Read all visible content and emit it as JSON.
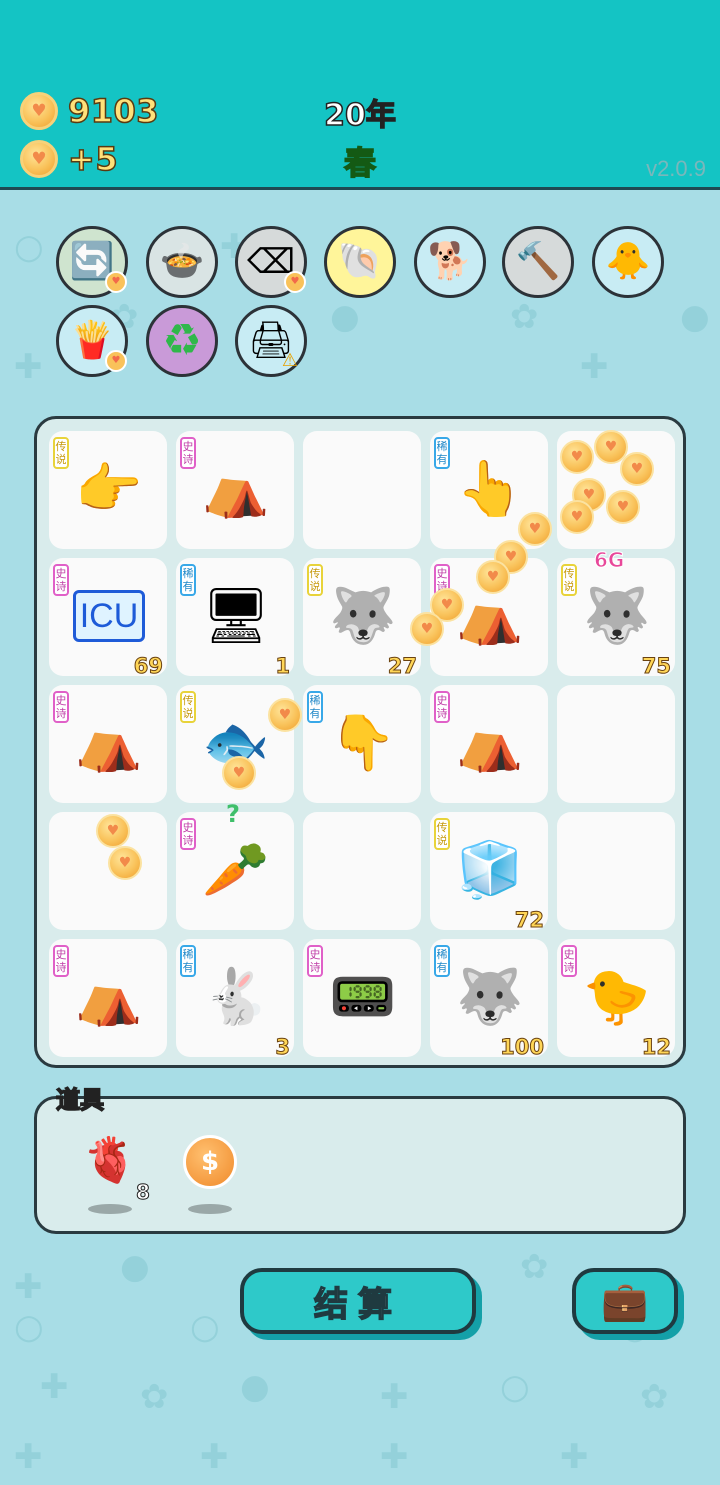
{
  "header": {
    "coins": "9103",
    "income": "+5",
    "year": "20年",
    "season": "春",
    "version": "v2.0.9"
  },
  "tools": [
    {
      "name": "refresh-tool",
      "icon": "🔄",
      "bg": "#cfe4cf"
    },
    {
      "name": "pot-tool",
      "icon": "🍲",
      "bg": "#d9e4e4"
    },
    {
      "name": "remove-tool",
      "icon": "⌫",
      "bg": "#d6dada"
    },
    {
      "name": "shell-tool",
      "icon": "🐚",
      "bg": "#fff59a"
    },
    {
      "name": "dog-tool",
      "icon": "🐕",
      "bg": "#c8ecf4"
    },
    {
      "name": "hammer-tool",
      "icon": "🔨",
      "bg": "#d6dada"
    },
    {
      "name": "chick-tool",
      "icon": "🐥",
      "bg": "#c8ecf4"
    },
    {
      "name": "fries-tool",
      "icon": "🍟",
      "bg": "#c8ecf4"
    },
    {
      "name": "recycle-tool",
      "icon": "♻",
      "bg": "#c99ad8"
    },
    {
      "name": "printer-tool",
      "icon": "🖨",
      "bg": "#c8ecf4"
    }
  ],
  "rarity": {
    "legend": "传说",
    "epic": "史诗",
    "rare": "稀有"
  },
  "grid": [
    [
      {
        "rarity": "legend",
        "icon": "👉",
        "count": ""
      },
      {
        "rarity": "epic",
        "icon": "⛺",
        "count": ""
      },
      {
        "rarity": "",
        "icon": "",
        "count": ""
      },
      {
        "rarity": "rare",
        "icon": "👆",
        "count": ""
      },
      {
        "rarity": "",
        "icon": "",
        "count": ""
      }
    ],
    [
      {
        "rarity": "epic",
        "icon": "ICU",
        "count": "69"
      },
      {
        "rarity": "rare",
        "icon": "🖥",
        "count": "1"
      },
      {
        "rarity": "legend",
        "icon": "🐺",
        "count": "27"
      },
      {
        "rarity": "epic",
        "icon": "⛺",
        "count": ""
      },
      {
        "rarity": "legend",
        "icon": "🐺",
        "count": "75"
      }
    ],
    [
      {
        "rarity": "epic",
        "icon": "⛺",
        "count": ""
      },
      {
        "rarity": "legend",
        "icon": "🐟",
        "count": ""
      },
      {
        "rarity": "rare",
        "icon": "👇",
        "count": ""
      },
      {
        "rarity": "epic",
        "icon": "⛺",
        "count": ""
      },
      {
        "rarity": "",
        "icon": "",
        "count": ""
      }
    ],
    [
      {
        "rarity": "",
        "icon": "",
        "count": ""
      },
      {
        "rarity": "epic",
        "icon": "🥕",
        "count": ""
      },
      {
        "rarity": "",
        "icon": "",
        "count": ""
      },
      {
        "rarity": "legend",
        "icon": "🧊",
        "count": "72"
      },
      {
        "rarity": "",
        "icon": "",
        "count": ""
      }
    ],
    [
      {
        "rarity": "epic",
        "icon": "⛺",
        "count": ""
      },
      {
        "rarity": "rare",
        "icon": "🐇",
        "count": "3"
      },
      {
        "rarity": "epic",
        "icon": "📟",
        "count": ""
      },
      {
        "rarity": "rare",
        "icon": "🐺",
        "count": "100"
      },
      {
        "rarity": "epic",
        "icon": "🐤",
        "count": "12"
      }
    ]
  ],
  "overlays": {
    "badge_6g": "6G",
    "carrot_question": "?"
  },
  "props": {
    "title": "道具",
    "items": [
      {
        "name": "liver-prop",
        "icon": "🫀",
        "count": "8"
      },
      {
        "name": "dollar-coin-prop",
        "icon": "$",
        "count": ""
      }
    ]
  },
  "buttons": {
    "settle": "结算",
    "bag_icon": "💼"
  }
}
